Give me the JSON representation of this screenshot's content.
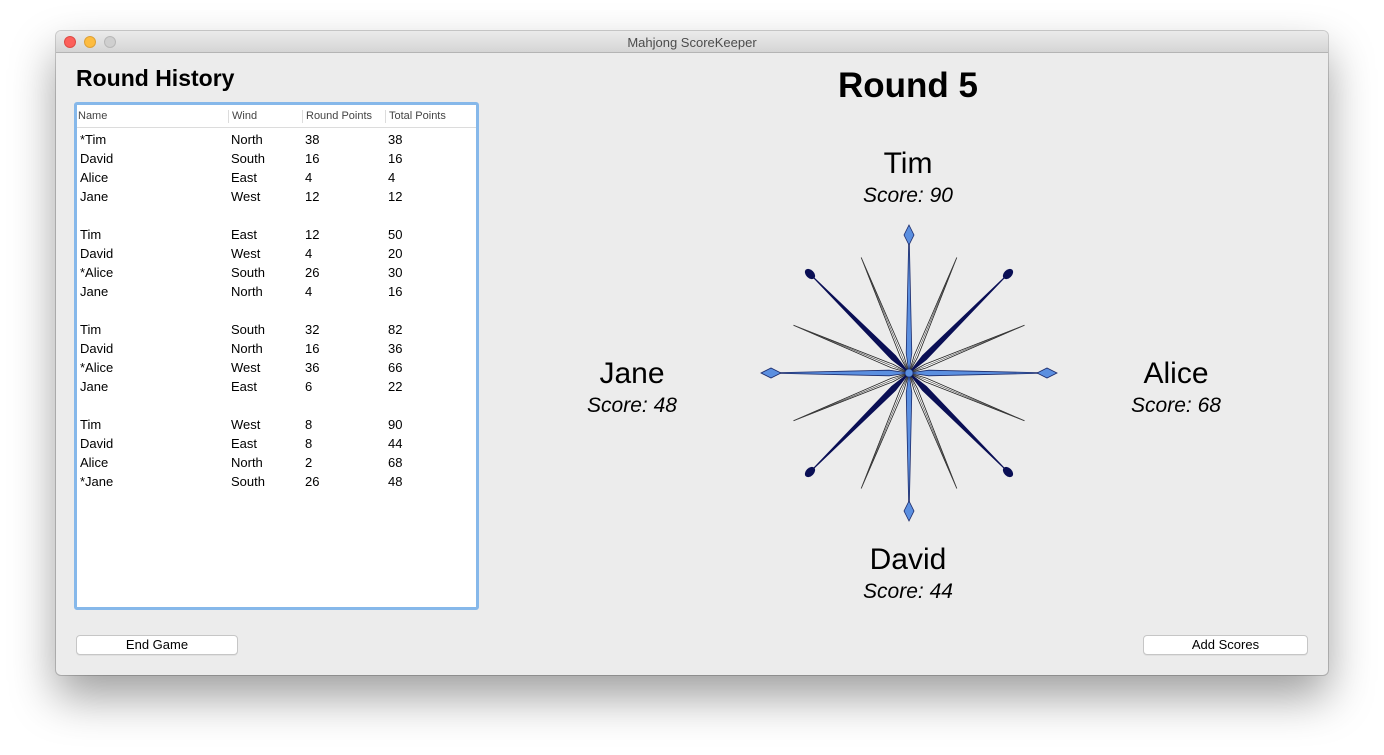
{
  "window": {
    "title": "Mahjong ScoreKeeper"
  },
  "history": {
    "title": "Round History",
    "columns": [
      "Name",
      "Wind",
      "Round Points",
      "Total Points"
    ],
    "rounds": [
      [
        {
          "name": "*Tim",
          "wind": "North",
          "round_points": "38",
          "total_points": "38"
        },
        {
          "name": "David",
          "wind": "South",
          "round_points": "16",
          "total_points": "16"
        },
        {
          "name": "Alice",
          "wind": "East",
          "round_points": "4",
          "total_points": "4"
        },
        {
          "name": "Jane",
          "wind": "West",
          "round_points": "12",
          "total_points": "12"
        }
      ],
      [
        {
          "name": "Tim",
          "wind": "East",
          "round_points": "12",
          "total_points": "50"
        },
        {
          "name": "David",
          "wind": "West",
          "round_points": "4",
          "total_points": "20"
        },
        {
          "name": "*Alice",
          "wind": "South",
          "round_points": "26",
          "total_points": "30"
        },
        {
          "name": "Jane",
          "wind": "North",
          "round_points": "4",
          "total_points": "16"
        }
      ],
      [
        {
          "name": "Tim",
          "wind": "South",
          "round_points": "32",
          "total_points": "82"
        },
        {
          "name": "David",
          "wind": "North",
          "round_points": "16",
          "total_points": "36"
        },
        {
          "name": "*Alice",
          "wind": "West",
          "round_points": "36",
          "total_points": "66"
        },
        {
          "name": "Jane",
          "wind": "East",
          "round_points": "6",
          "total_points": "22"
        }
      ],
      [
        {
          "name": "Tim",
          "wind": "West",
          "round_points": "8",
          "total_points": "90"
        },
        {
          "name": "David",
          "wind": "East",
          "round_points": "8",
          "total_points": "44"
        },
        {
          "name": "Alice",
          "wind": "North",
          "round_points": "2",
          "total_points": "68"
        },
        {
          "name": "*Jane",
          "wind": "South",
          "round_points": "26",
          "total_points": "48"
        }
      ]
    ]
  },
  "round": {
    "title": "Round 5"
  },
  "players": {
    "north": {
      "name": "Tim",
      "score": "Score: 90"
    },
    "west": {
      "name": "Jane",
      "score": "Score: 48"
    },
    "east": {
      "name": "Alice",
      "score": "Score: 68"
    },
    "south": {
      "name": "David",
      "score": "Score: 44"
    }
  },
  "buttons": {
    "end_game": "End Game",
    "add_scores": "Add Scores"
  },
  "colors": {
    "compass_light": "#5b8fe0",
    "compass_dark": "#0a0f55",
    "table_focus": "#86b8ea"
  },
  "icons": {
    "compass": "compass-rose-icon"
  }
}
